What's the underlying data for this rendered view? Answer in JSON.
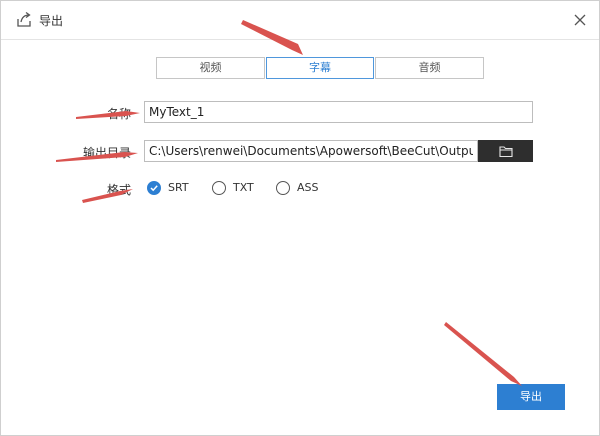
{
  "dialog": {
    "title": "导出",
    "icons": {
      "title": "export-icon",
      "close": "close-icon"
    }
  },
  "tabs": [
    {
      "label": "视频",
      "active": false
    },
    {
      "label": "字幕",
      "active": true
    },
    {
      "label": "音频",
      "active": false
    }
  ],
  "form": {
    "name_label": "名称",
    "name_value": "MyText_1",
    "output_label": "输出目录",
    "output_value": "C:\\Users\\renwei\\Documents\\Apowersoft\\BeeCut\\Output",
    "browse_icon": "folder-icon",
    "format_label": "格式",
    "formats": [
      {
        "label": "SRT",
        "checked": true
      },
      {
        "label": "TXT",
        "checked": false
      },
      {
        "label": "ASS",
        "checked": false
      }
    ]
  },
  "footer": {
    "export_label": "导出"
  },
  "colors": {
    "accent": "#2d7fd2",
    "annotation_arrow": "#d9534f",
    "browse_bg": "#2e2e2e"
  }
}
